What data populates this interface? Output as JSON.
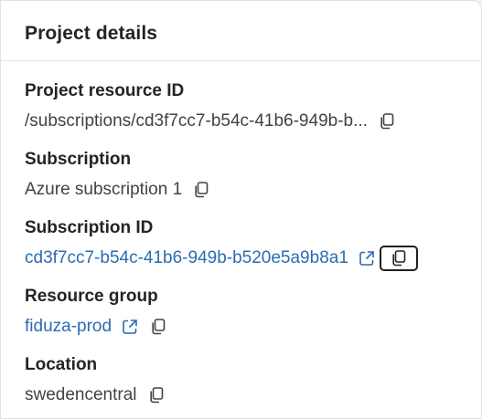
{
  "card": {
    "title": "Project details"
  },
  "fields": {
    "project_resource_id": {
      "label": "Project resource ID",
      "value": "/subscriptions/cd3f7cc7-b54c-41b6-949b-b..."
    },
    "subscription": {
      "label": "Subscription",
      "value": "Azure subscription 1"
    },
    "subscription_id": {
      "label": "Subscription ID",
      "value": "cd3f7cc7-b54c-41b6-949b-b520e5a9b8a1"
    },
    "resource_group": {
      "label": "Resource group",
      "value": "fiduza-prod"
    },
    "location": {
      "label": "Location",
      "value": "swedencentral"
    }
  },
  "icons": {
    "copy": "copy-icon",
    "open_external": "open-external-icon"
  },
  "colors": {
    "link": "#2b6cb3",
    "text": "#242424",
    "muted_text": "#424242",
    "focus_border": "#1f1f1f"
  }
}
